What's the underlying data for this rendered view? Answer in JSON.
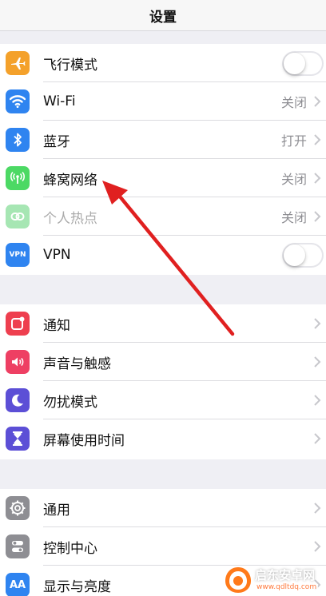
{
  "nav": {
    "title": "设置"
  },
  "group1": {
    "airplane": {
      "label": "飞行模式",
      "icon": "airplane-icon",
      "toggle_on": false,
      "color": "#f4a12b"
    },
    "wifi": {
      "label": "Wi-Fi",
      "value": "关闭",
      "icon": "wifi-icon",
      "color": "#2f84f0"
    },
    "bluetooth": {
      "label": "蓝牙",
      "value": "打开",
      "icon": "bluetooth-icon",
      "color": "#2f84f0"
    },
    "cellular": {
      "label": "蜂窝网络",
      "value": "关闭",
      "icon": "antenna-icon",
      "color": "#4cd964"
    },
    "hotspot": {
      "label": "个人热点",
      "value": "关闭",
      "icon": "link-icon",
      "color": "#a6e6b3",
      "disabled": true
    },
    "vpn": {
      "label": "VPN",
      "icon_text": "VPN",
      "toggle_on": false,
      "color": "#2f84f0"
    }
  },
  "group2": {
    "notifications": {
      "label": "通知",
      "icon": "notification-icon",
      "color": "#ee3f4f"
    },
    "sounds": {
      "label": "声音与触感",
      "icon": "speaker-icon",
      "color": "#ee3f63"
    },
    "dnd": {
      "label": "勿扰模式",
      "icon": "moon-icon",
      "color": "#5c4fd6"
    },
    "screentime": {
      "label": "屏幕使用时间",
      "icon": "hourglass-icon",
      "color": "#5c4fd6"
    }
  },
  "group3": {
    "general": {
      "label": "通用",
      "icon": "gear-icon",
      "color": "#8e8e93"
    },
    "control": {
      "label": "控制中心",
      "icon": "toggles-icon",
      "color": "#8e8e93"
    },
    "display": {
      "label": "显示与亮度",
      "icon_text": "AA",
      "color": "#2f84f0"
    }
  },
  "annotation": {
    "arrow_color": "#e02020"
  },
  "watermark": {
    "name": "启东安卓网",
    "url": "www.qdltdq.com"
  }
}
